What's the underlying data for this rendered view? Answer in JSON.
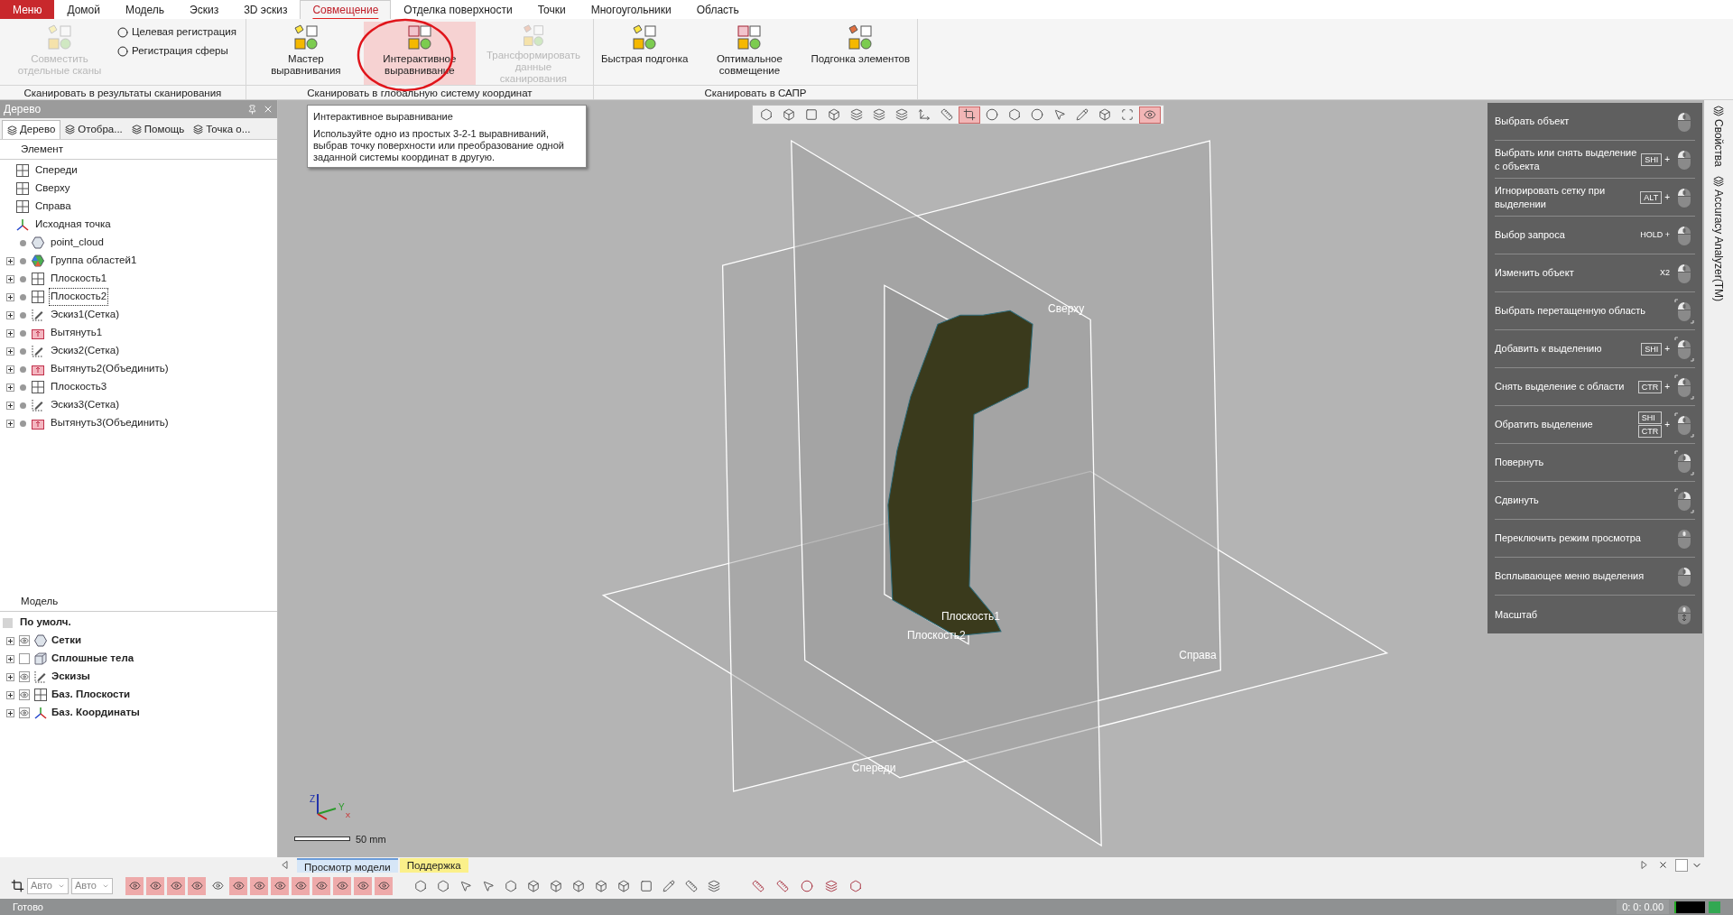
{
  "menu_tabs": [
    {
      "label": "Меню",
      "kind": "app",
      "selected": false
    },
    {
      "label": "Домой",
      "kind": "tab",
      "selected": false
    },
    {
      "label": "Модель",
      "kind": "tab",
      "selected": false
    },
    {
      "label": "Эскиз",
      "kind": "tab",
      "selected": false
    },
    {
      "label": "3D эскиз",
      "kind": "tab",
      "selected": false
    },
    {
      "label": "Совмещение",
      "kind": "tab",
      "selected": true
    },
    {
      "label": "Отделка поверхности",
      "kind": "tab",
      "selected": false
    },
    {
      "label": "Точки",
      "kind": "tab",
      "selected": false
    },
    {
      "label": "Многоугольники",
      "kind": "tab",
      "selected": false
    },
    {
      "label": "Область",
      "kind": "tab",
      "selected": false
    }
  ],
  "ribbon_groups": [
    {
      "label": "Сканировать в результаты сканирования",
      "buttons": [
        {
          "kind": "large",
          "label": "Совместить отдельные сканы",
          "disabled": true,
          "highlighted": false
        },
        {
          "kind": "small",
          "label": "Целевая регистрация",
          "disabled": false,
          "highlighted": false
        },
        {
          "kind": "small",
          "label": "Регистрация сферы",
          "disabled": false,
          "highlighted": false
        }
      ]
    },
    {
      "label": "Сканировать в глобальную систему координат",
      "buttons": [
        {
          "kind": "large",
          "label": "Мастер выравнивания",
          "disabled": false,
          "highlighted": false
        },
        {
          "kind": "large",
          "label": "Интерактивное выравнивание",
          "disabled": false,
          "highlighted": true
        },
        {
          "kind": "large",
          "label": "Трансформировать данные сканирования",
          "disabled": true,
          "highlighted": false
        }
      ]
    },
    {
      "label": "Сканировать в САПР",
      "buttons": [
        {
          "kind": "large",
          "label": "Быстрая подгонка",
          "disabled": false,
          "highlighted": false
        },
        {
          "kind": "large",
          "label": "Оптимальное совмещение",
          "disabled": false,
          "highlighted": false
        },
        {
          "kind": "large",
          "label": "Подгонка элементов",
          "disabled": false,
          "highlighted": false
        }
      ]
    }
  ],
  "tooltip": {
    "title": "Интерактивное выравнивание",
    "body": "Используйте одно из простых 3-2-1 выравниваний, выбрав точку поверхности или преобразование одной заданной системы координат в другую."
  },
  "left_panel": {
    "title": "Дерево",
    "tabs": [
      {
        "label": "Дерево",
        "selected": true
      },
      {
        "label": "Отобра...",
        "selected": false
      },
      {
        "label": "Помощь",
        "selected": false
      },
      {
        "label": "Точка о...",
        "selected": false
      }
    ],
    "tree_header": "Элемент",
    "tree_items": [
      {
        "label": "Спереди",
        "kind": "plane",
        "expandable": false,
        "status_dot": false,
        "focused": false
      },
      {
        "label": "Сверху",
        "kind": "plane",
        "expandable": false,
        "status_dot": false,
        "focused": false
      },
      {
        "label": "Справа",
        "kind": "plane",
        "expandable": false,
        "status_dot": false,
        "focused": false
      },
      {
        "label": "Исходная точка",
        "kind": "origin",
        "expandable": false,
        "status_dot": false,
        "focused": false
      },
      {
        "label": "point_cloud",
        "kind": "mesh",
        "expandable": false,
        "status_dot": true,
        "focused": false
      },
      {
        "label": "Группа областей1",
        "kind": "region",
        "expandable": true,
        "status_dot": true,
        "focused": false
      },
      {
        "label": "Плоскость1",
        "kind": "plane",
        "expandable": true,
        "status_dot": true,
        "focused": false
      },
      {
        "label": "Плоскость2",
        "kind": "plane",
        "expandable": true,
        "status_dot": true,
        "focused": true
      },
      {
        "label": "Эскиз1(Сетка)",
        "kind": "sketch",
        "expandable": true,
        "status_dot": true,
        "focused": false
      },
      {
        "label": "Вытянуть1",
        "kind": "extrude",
        "expandable": true,
        "status_dot": true,
        "focused": false
      },
      {
        "label": "Эскиз2(Сетка)",
        "kind": "sketch",
        "expandable": true,
        "status_dot": true,
        "focused": false
      },
      {
        "label": "Вытянуть2(Объединить)",
        "kind": "extrude",
        "expandable": true,
        "status_dot": true,
        "focused": false
      },
      {
        "label": "Плоскость3",
        "kind": "plane",
        "expandable": true,
        "status_dot": true,
        "focused": false
      },
      {
        "label": "Эскиз3(Сетка)",
        "kind": "sketch",
        "expandable": true,
        "status_dot": true,
        "focused": false
      },
      {
        "label": "Вытянуть3(Объединить)",
        "kind": "extrude",
        "expandable": true,
        "status_dot": true,
        "focused": false
      }
    ],
    "model_header": "Модель",
    "model_default": "По умолч.",
    "model_items": [
      {
        "label": "Сетки",
        "kind": "mesh",
        "visible": true
      },
      {
        "label": "Сплошные тела",
        "kind": "solid",
        "visible": false
      },
      {
        "label": "Эскизы",
        "kind": "sketch",
        "visible": true
      },
      {
        "label": "Баз. Плоскости",
        "kind": "plane",
        "visible": true
      },
      {
        "label": "Баз. Координаты",
        "kind": "origin",
        "visible": true
      }
    ]
  },
  "viewport": {
    "toolbar": [
      {
        "on": false
      },
      {
        "on": false
      },
      {
        "on": false
      },
      {
        "on": false
      },
      {
        "on": false
      },
      {
        "on": false
      },
      {
        "on": false
      },
      {
        "on": false
      },
      {
        "on": false
      },
      {
        "on": true
      },
      {
        "on": false
      },
      {
        "on": false
      },
      {
        "on": false
      },
      {
        "on": false
      },
      {
        "on": false
      },
      {
        "on": false
      },
      {
        "on": false
      },
      {
        "on": true
      }
    ],
    "labels": [
      "Сверху",
      "Справа",
      "Спереди",
      "Плоскость1",
      "Плоскость2"
    ],
    "axes": [
      "Z",
      "Y",
      "X"
    ],
    "scale": "50 mm"
  },
  "mouse_help": [
    {
      "label": "Выбрать объект",
      "kind": "left",
      "drag": false
    },
    {
      "label": "Выбрать или снять выделение с объекта",
      "keys": [
        "SHI"
      ],
      "joiner": "+",
      "kind": "left",
      "drag": false
    },
    {
      "label": "Игнорировать сетку при выделении",
      "keys": [
        "ALT"
      ],
      "joiner": "+",
      "kind": "left",
      "drag": false
    },
    {
      "label": "Выбор запроса",
      "note": "HOLD +",
      "kind": "left",
      "drag": false
    },
    {
      "label": "Изменить объект",
      "note": "X2",
      "kind": "left",
      "drag": false
    },
    {
      "label": "Выбрать перетащенную область",
      "kind": "left",
      "drag": true
    },
    {
      "label": "Добавить к выделению",
      "keys": [
        "SHI"
      ],
      "joiner": "+",
      "kind": "left",
      "drag": true
    },
    {
      "label": "Снять выделение с области",
      "keys": [
        "CTR"
      ],
      "joiner": "+",
      "kind": "left",
      "drag": true
    },
    {
      "label": "Обратить выделение",
      "keys": [
        "SHI",
        "CTR"
      ],
      "joiner": "+",
      "kind": "left",
      "drag": true
    },
    {
      "label": "Повернуть",
      "kind": "right",
      "drag": true
    },
    {
      "label": "Сдвинуть",
      "kind": "right",
      "drag": true
    },
    {
      "label": "Переключить режим просмотра",
      "kind": "middle",
      "drag": false
    },
    {
      "label": "Всплывающее меню выделения",
      "kind": "right",
      "drag": false
    },
    {
      "label": "Масштаб",
      "kind": "wheel",
      "drag": false
    }
  ],
  "side_tabs": [
    "Свойства",
    "Accuracy Analyzer(TM)"
  ],
  "bottom_tabs": [
    {
      "label": "Просмотр модели",
      "selected": true,
      "color": "#d6e6f7"
    },
    {
      "label": "Поддержка",
      "selected": false,
      "color": "#fbf08a"
    }
  ],
  "bottom_toolbar": {
    "combos": [
      "Авто",
      "Авто"
    ],
    "filters": [
      {
        "on": true
      },
      {
        "on": true
      },
      {
        "on": true
      },
      {
        "on": true
      },
      {
        "on": false
      },
      {
        "on": true
      },
      {
        "on": true
      },
      {
        "on": true
      },
      {
        "on": true
      },
      {
        "on": true
      },
      {
        "on": true
      },
      {
        "on": true
      },
      {
        "on": true
      }
    ],
    "selectors": [
      {
        "on": false
      },
      {
        "on": false
      },
      {
        "on": false
      },
      {
        "on": false
      },
      {
        "on": false
      },
      {
        "on": false
      },
      {
        "on": false
      },
      {
        "on": false
      },
      {
        "on": false
      },
      {
        "on": false
      },
      {
        "on": false
      },
      {
        "on": false
      },
      {
        "on": false
      },
      {
        "on": false
      }
    ],
    "measure": [
      {
        "on": false
      },
      {
        "on": false
      },
      {
        "on": false
      },
      {
        "on": false
      },
      {
        "on": false
      }
    ]
  },
  "status_bar": {
    "text": "Готово",
    "time": "0: 0: 0.00"
  }
}
